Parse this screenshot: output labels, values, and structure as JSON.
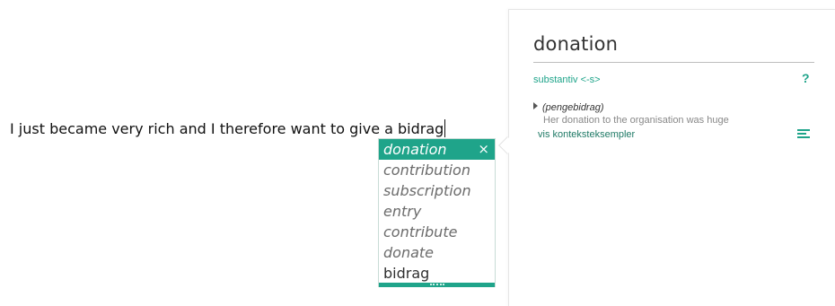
{
  "editor": {
    "text": "I just became very rich and I therefore want to give a bidrag"
  },
  "suggestions": {
    "items": [
      {
        "label": "donation",
        "selected": true
      },
      {
        "label": "contribution"
      },
      {
        "label": "subscription"
      },
      {
        "label": "entry"
      },
      {
        "label": "contribute"
      },
      {
        "label": "donate"
      }
    ],
    "original": "bidrag",
    "close_label": "×"
  },
  "dictionary": {
    "headword": "donation",
    "part_of_speech": "substantiv <-s>",
    "help_label": "?",
    "sense_label": "(pengebidrag)",
    "sense_example": "Her donation to the organisation was huge",
    "context_link": "vis konteksteksempler"
  },
  "colors": {
    "accent": "#1fa48a",
    "text": "#111111"
  }
}
